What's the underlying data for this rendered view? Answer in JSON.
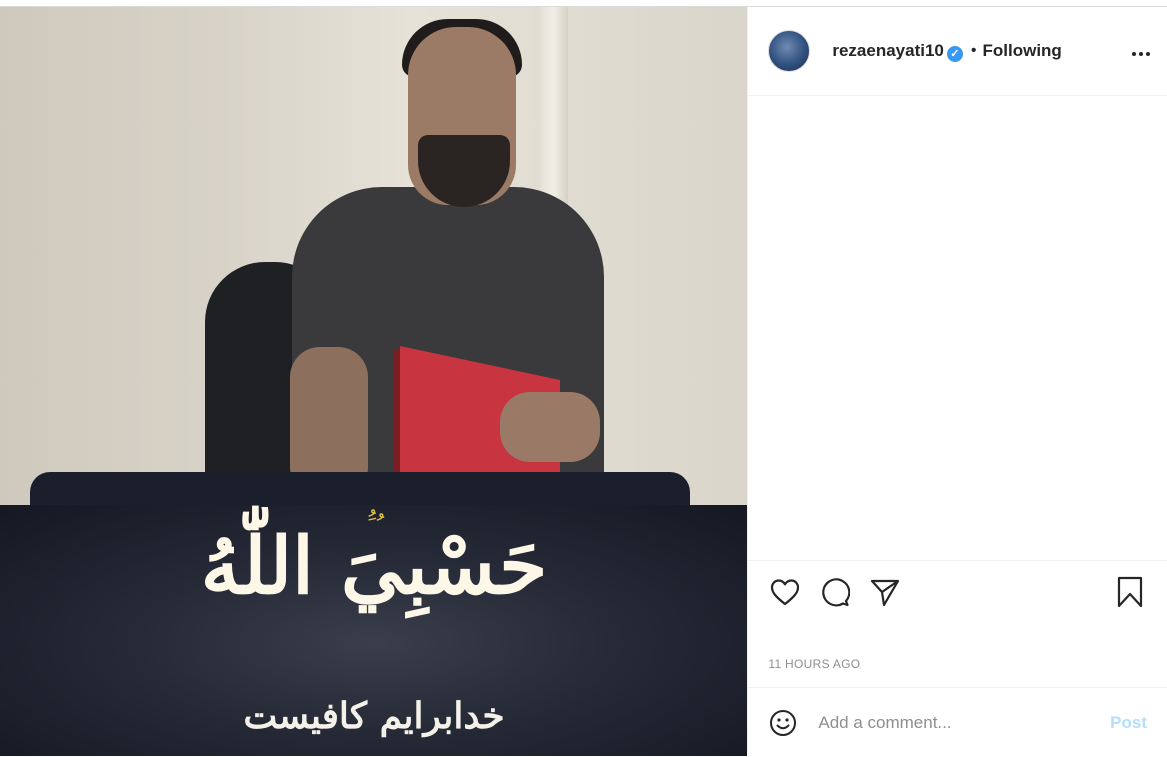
{
  "post": {
    "author": {
      "username": "rezaenayati10",
      "verified_mark": "✓",
      "separator": "•",
      "follow_status": "Following",
      "more_label": "•••"
    },
    "image": {
      "calligraphy_main": "حَسْبِيَ اللّٰهُ",
      "calligraphy_marks": "ُ َ ُ",
      "caption_overlay": "خدابرایم کافیست"
    },
    "actions": {
      "like_icon": "heart-icon",
      "comment_icon": "comment-icon",
      "share_icon": "send-icon",
      "save_icon": "bookmark-icon"
    },
    "timestamp": "11 HOURS AGO",
    "comment_box": {
      "placeholder": "Add a comment...",
      "emoji_icon": "emoji-icon",
      "post_label": "Post"
    }
  },
  "colors": {
    "text": "#262626",
    "muted": "#8e8e8e",
    "verified_blue": "#3897f0",
    "post_disabled": "#b2dffc",
    "divider": "#efefef"
  }
}
